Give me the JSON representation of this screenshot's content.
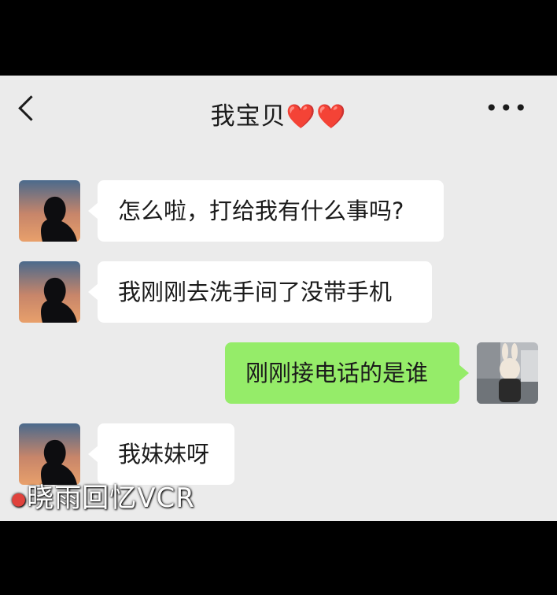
{
  "header": {
    "title": "我宝贝",
    "hearts": "❤️❤️",
    "back_icon": "chevron-left-icon",
    "more_icon": "more-icon",
    "more_glyph": "•••"
  },
  "messages": [
    {
      "side": "in",
      "text": "怎么啦，打给我有什么事吗?"
    },
    {
      "side": "in",
      "text": "我刚刚去洗手间了没带手机"
    },
    {
      "side": "out",
      "text": "刚刚接电话的是谁"
    },
    {
      "side": "in",
      "text": "我妹妹呀"
    }
  ],
  "colors": {
    "chat_bg": "#ebebeb",
    "incoming_bubble": "#ffffff",
    "outgoing_bubble": "#95ec69",
    "heart": "#d1261c"
  },
  "watermark": {
    "text": "晓雨回忆VCR"
  }
}
